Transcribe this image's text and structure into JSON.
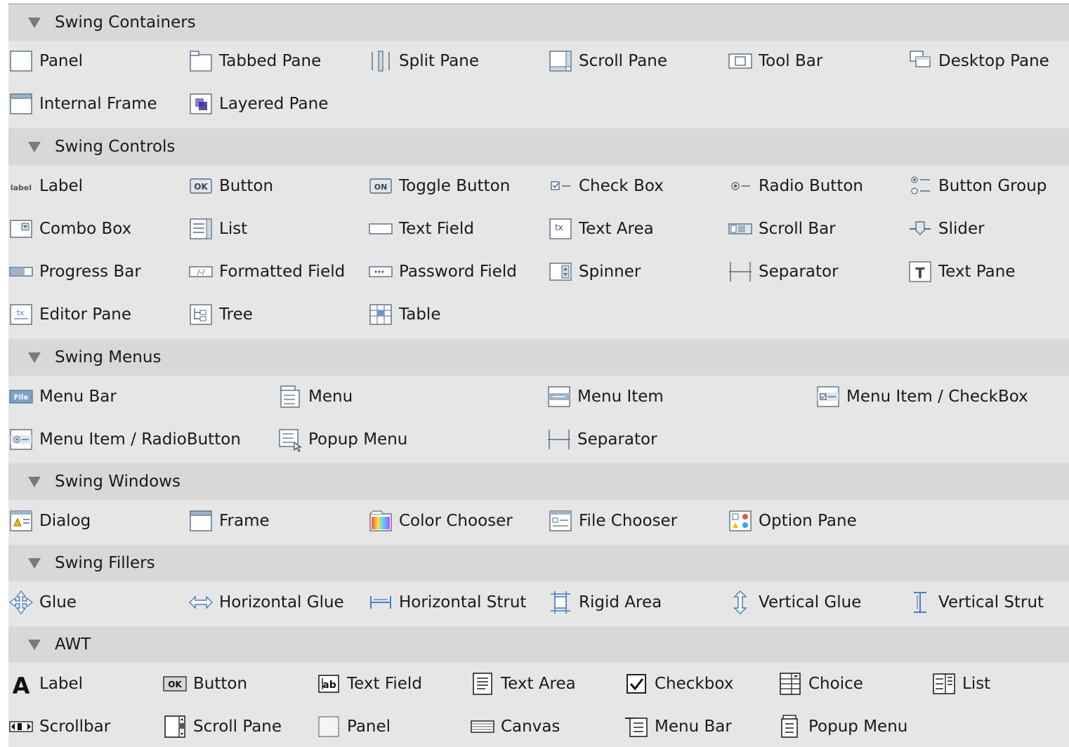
{
  "palette": {
    "categories": [
      {
        "title": "Swing Containers",
        "items": [
          {
            "label": "Panel",
            "icon": "panel-icon"
          },
          {
            "label": "Tabbed Pane",
            "icon": "tabbed-pane-icon"
          },
          {
            "label": "Split Pane",
            "icon": "split-pane-icon"
          },
          {
            "label": "Scroll Pane",
            "icon": "scroll-pane-icon"
          },
          {
            "label": "Tool Bar",
            "icon": "tool-bar-icon"
          },
          {
            "label": "Desktop Pane",
            "icon": "desktop-pane-icon"
          },
          {
            "label": "Internal Frame",
            "icon": "internal-frame-icon"
          },
          {
            "label": "Layered Pane",
            "icon": "layered-pane-icon"
          }
        ]
      },
      {
        "title": "Swing Controls",
        "items": [
          {
            "label": "Label",
            "icon": "label-icon",
            "icon_text": "label"
          },
          {
            "label": "Button",
            "icon": "button-icon",
            "icon_text": "OK"
          },
          {
            "label": "Toggle Button",
            "icon": "toggle-button-icon",
            "icon_text": "ON"
          },
          {
            "label": "Check Box",
            "icon": "check-box-icon"
          },
          {
            "label": "Radio Button",
            "icon": "radio-button-icon"
          },
          {
            "label": "Button Group",
            "icon": "button-group-icon"
          },
          {
            "label": "Combo Box",
            "icon": "combo-box-icon"
          },
          {
            "label": "List",
            "icon": "list-icon"
          },
          {
            "label": "Text Field",
            "icon": "text-field-icon"
          },
          {
            "label": "Text Area",
            "icon": "text-area-icon",
            "icon_text": "tx"
          },
          {
            "label": "Scroll Bar",
            "icon": "scroll-bar-icon"
          },
          {
            "label": "Slider",
            "icon": "slider-icon"
          },
          {
            "label": "Progress Bar",
            "icon": "progress-bar-icon"
          },
          {
            "label": "Formatted Field",
            "icon": "formatted-field-icon"
          },
          {
            "label": "Password Field",
            "icon": "password-field-icon"
          },
          {
            "label": "Spinner",
            "icon": "spinner-icon"
          },
          {
            "label": "Separator",
            "icon": "separator-icon"
          },
          {
            "label": "Text Pane",
            "icon": "text-pane-icon",
            "icon_text": "T"
          },
          {
            "label": "Editor Pane",
            "icon": "editor-pane-icon"
          },
          {
            "label": "Tree",
            "icon": "tree-icon"
          },
          {
            "label": "Table",
            "icon": "table-icon"
          }
        ]
      },
      {
        "title": "Swing Menus",
        "items": [
          {
            "label": "Menu Bar",
            "icon": "menu-bar-icon",
            "icon_text": "File"
          },
          {
            "label": "Menu",
            "icon": "menu-icon"
          },
          {
            "label": "Menu Item",
            "icon": "menu-item-icon"
          },
          {
            "label": "Menu Item / CheckBox",
            "icon": "menu-item-checkbox-icon"
          },
          {
            "label": "Menu Item / RadioButton",
            "icon": "menu-item-radiobutton-icon"
          },
          {
            "label": "Popup Menu",
            "icon": "popup-menu-icon"
          },
          {
            "label": "Separator",
            "icon": "menu-separator-icon"
          }
        ]
      },
      {
        "title": "Swing Windows",
        "items": [
          {
            "label": "Dialog",
            "icon": "dialog-icon"
          },
          {
            "label": "Frame",
            "icon": "frame-icon"
          },
          {
            "label": "Color Chooser",
            "icon": "color-chooser-icon"
          },
          {
            "label": "File Chooser",
            "icon": "file-chooser-icon"
          },
          {
            "label": "Option Pane",
            "icon": "option-pane-icon"
          }
        ]
      },
      {
        "title": "Swing Fillers",
        "items": [
          {
            "label": "Glue",
            "icon": "glue-icon"
          },
          {
            "label": "Horizontal Glue",
            "icon": "horizontal-glue-icon"
          },
          {
            "label": "Horizontal Strut",
            "icon": "horizontal-strut-icon"
          },
          {
            "label": "Rigid Area",
            "icon": "rigid-area-icon"
          },
          {
            "label": "Vertical Glue",
            "icon": "vertical-glue-icon"
          },
          {
            "label": "Vertical Strut",
            "icon": "vertical-strut-icon"
          }
        ]
      },
      {
        "title": "AWT",
        "items": [
          {
            "label": "Label",
            "icon": "awt-label-icon",
            "icon_text": "A"
          },
          {
            "label": "Button",
            "icon": "awt-button-icon",
            "icon_text": "OK"
          },
          {
            "label": "Text Field",
            "icon": "awt-text-field-icon",
            "icon_text": "ab"
          },
          {
            "label": "Text Area",
            "icon": "awt-text-area-icon"
          },
          {
            "label": "Checkbox",
            "icon": "awt-checkbox-icon"
          },
          {
            "label": "Choice",
            "icon": "awt-choice-icon"
          },
          {
            "label": "List",
            "icon": "awt-list-icon"
          },
          {
            "label": "Scrollbar",
            "icon": "awt-scrollbar-icon"
          },
          {
            "label": "Scroll Pane",
            "icon": "awt-scroll-pane-icon"
          },
          {
            "label": "Panel",
            "icon": "awt-panel-icon"
          },
          {
            "label": "Canvas",
            "icon": "awt-canvas-icon"
          },
          {
            "label": "Menu Bar",
            "icon": "awt-menu-bar-icon"
          },
          {
            "label": "Popup Menu",
            "icon": "awt-popup-menu-icon"
          }
        ]
      }
    ],
    "colors": {
      "background": "#e6e6e6",
      "header": "#d8d8d8",
      "icon_stroke": "#5a6d80",
      "icon_fill": "#ffffff",
      "accent_blue": "#4a7fc0"
    }
  }
}
